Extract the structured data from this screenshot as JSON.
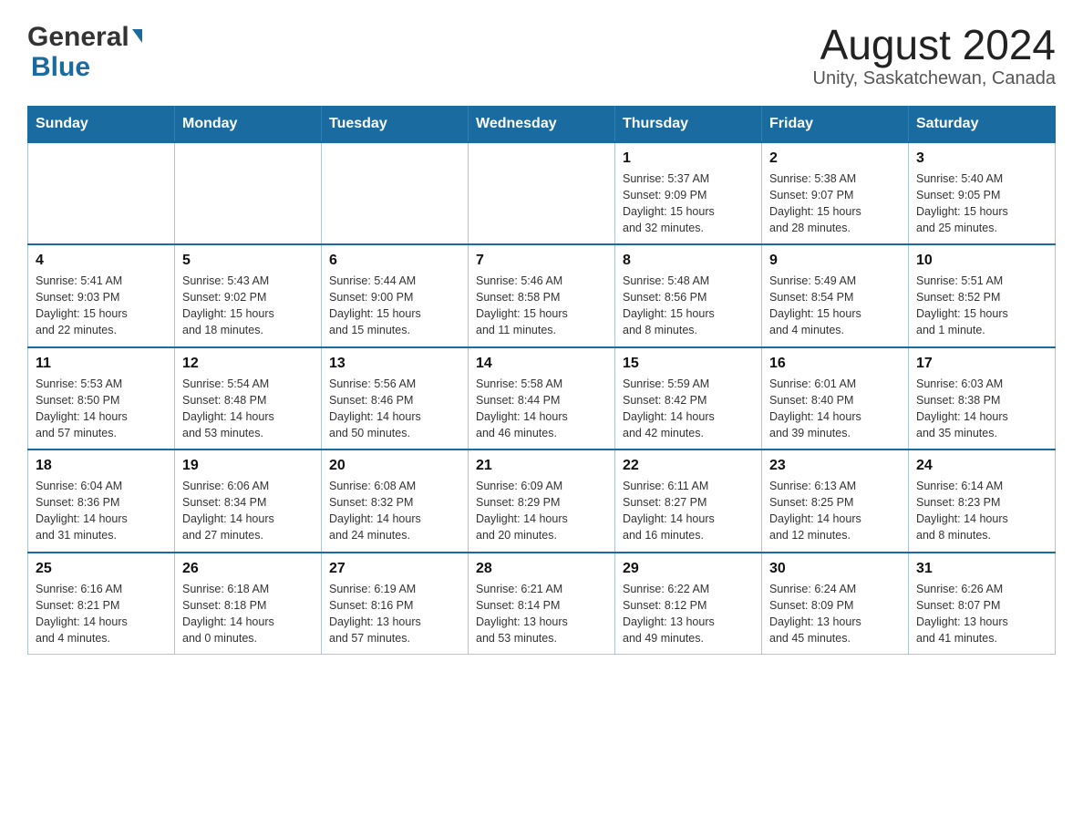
{
  "header": {
    "logo_general": "General",
    "logo_blue": "Blue",
    "month_year": "August 2024",
    "location": "Unity, Saskatchewan, Canada"
  },
  "days_of_week": [
    "Sunday",
    "Monday",
    "Tuesday",
    "Wednesday",
    "Thursday",
    "Friday",
    "Saturday"
  ],
  "weeks": [
    {
      "days": [
        {
          "num": "",
          "info": ""
        },
        {
          "num": "",
          "info": ""
        },
        {
          "num": "",
          "info": ""
        },
        {
          "num": "",
          "info": ""
        },
        {
          "num": "1",
          "info": "Sunrise: 5:37 AM\nSunset: 9:09 PM\nDaylight: 15 hours\nand 32 minutes."
        },
        {
          "num": "2",
          "info": "Sunrise: 5:38 AM\nSunset: 9:07 PM\nDaylight: 15 hours\nand 28 minutes."
        },
        {
          "num": "3",
          "info": "Sunrise: 5:40 AM\nSunset: 9:05 PM\nDaylight: 15 hours\nand 25 minutes."
        }
      ]
    },
    {
      "days": [
        {
          "num": "4",
          "info": "Sunrise: 5:41 AM\nSunset: 9:03 PM\nDaylight: 15 hours\nand 22 minutes."
        },
        {
          "num": "5",
          "info": "Sunrise: 5:43 AM\nSunset: 9:02 PM\nDaylight: 15 hours\nand 18 minutes."
        },
        {
          "num": "6",
          "info": "Sunrise: 5:44 AM\nSunset: 9:00 PM\nDaylight: 15 hours\nand 15 minutes."
        },
        {
          "num": "7",
          "info": "Sunrise: 5:46 AM\nSunset: 8:58 PM\nDaylight: 15 hours\nand 11 minutes."
        },
        {
          "num": "8",
          "info": "Sunrise: 5:48 AM\nSunset: 8:56 PM\nDaylight: 15 hours\nand 8 minutes."
        },
        {
          "num": "9",
          "info": "Sunrise: 5:49 AM\nSunset: 8:54 PM\nDaylight: 15 hours\nand 4 minutes."
        },
        {
          "num": "10",
          "info": "Sunrise: 5:51 AM\nSunset: 8:52 PM\nDaylight: 15 hours\nand 1 minute."
        }
      ]
    },
    {
      "days": [
        {
          "num": "11",
          "info": "Sunrise: 5:53 AM\nSunset: 8:50 PM\nDaylight: 14 hours\nand 57 minutes."
        },
        {
          "num": "12",
          "info": "Sunrise: 5:54 AM\nSunset: 8:48 PM\nDaylight: 14 hours\nand 53 minutes."
        },
        {
          "num": "13",
          "info": "Sunrise: 5:56 AM\nSunset: 8:46 PM\nDaylight: 14 hours\nand 50 minutes."
        },
        {
          "num": "14",
          "info": "Sunrise: 5:58 AM\nSunset: 8:44 PM\nDaylight: 14 hours\nand 46 minutes."
        },
        {
          "num": "15",
          "info": "Sunrise: 5:59 AM\nSunset: 8:42 PM\nDaylight: 14 hours\nand 42 minutes."
        },
        {
          "num": "16",
          "info": "Sunrise: 6:01 AM\nSunset: 8:40 PM\nDaylight: 14 hours\nand 39 minutes."
        },
        {
          "num": "17",
          "info": "Sunrise: 6:03 AM\nSunset: 8:38 PM\nDaylight: 14 hours\nand 35 minutes."
        }
      ]
    },
    {
      "days": [
        {
          "num": "18",
          "info": "Sunrise: 6:04 AM\nSunset: 8:36 PM\nDaylight: 14 hours\nand 31 minutes."
        },
        {
          "num": "19",
          "info": "Sunrise: 6:06 AM\nSunset: 8:34 PM\nDaylight: 14 hours\nand 27 minutes."
        },
        {
          "num": "20",
          "info": "Sunrise: 6:08 AM\nSunset: 8:32 PM\nDaylight: 14 hours\nand 24 minutes."
        },
        {
          "num": "21",
          "info": "Sunrise: 6:09 AM\nSunset: 8:29 PM\nDaylight: 14 hours\nand 20 minutes."
        },
        {
          "num": "22",
          "info": "Sunrise: 6:11 AM\nSunset: 8:27 PM\nDaylight: 14 hours\nand 16 minutes."
        },
        {
          "num": "23",
          "info": "Sunrise: 6:13 AM\nSunset: 8:25 PM\nDaylight: 14 hours\nand 12 minutes."
        },
        {
          "num": "24",
          "info": "Sunrise: 6:14 AM\nSunset: 8:23 PM\nDaylight: 14 hours\nand 8 minutes."
        }
      ]
    },
    {
      "days": [
        {
          "num": "25",
          "info": "Sunrise: 6:16 AM\nSunset: 8:21 PM\nDaylight: 14 hours\nand 4 minutes."
        },
        {
          "num": "26",
          "info": "Sunrise: 6:18 AM\nSunset: 8:18 PM\nDaylight: 14 hours\nand 0 minutes."
        },
        {
          "num": "27",
          "info": "Sunrise: 6:19 AM\nSunset: 8:16 PM\nDaylight: 13 hours\nand 57 minutes."
        },
        {
          "num": "28",
          "info": "Sunrise: 6:21 AM\nSunset: 8:14 PM\nDaylight: 13 hours\nand 53 minutes."
        },
        {
          "num": "29",
          "info": "Sunrise: 6:22 AM\nSunset: 8:12 PM\nDaylight: 13 hours\nand 49 minutes."
        },
        {
          "num": "30",
          "info": "Sunrise: 6:24 AM\nSunset: 8:09 PM\nDaylight: 13 hours\nand 45 minutes."
        },
        {
          "num": "31",
          "info": "Sunrise: 6:26 AM\nSunset: 8:07 PM\nDaylight: 13 hours\nand 41 minutes."
        }
      ]
    }
  ]
}
